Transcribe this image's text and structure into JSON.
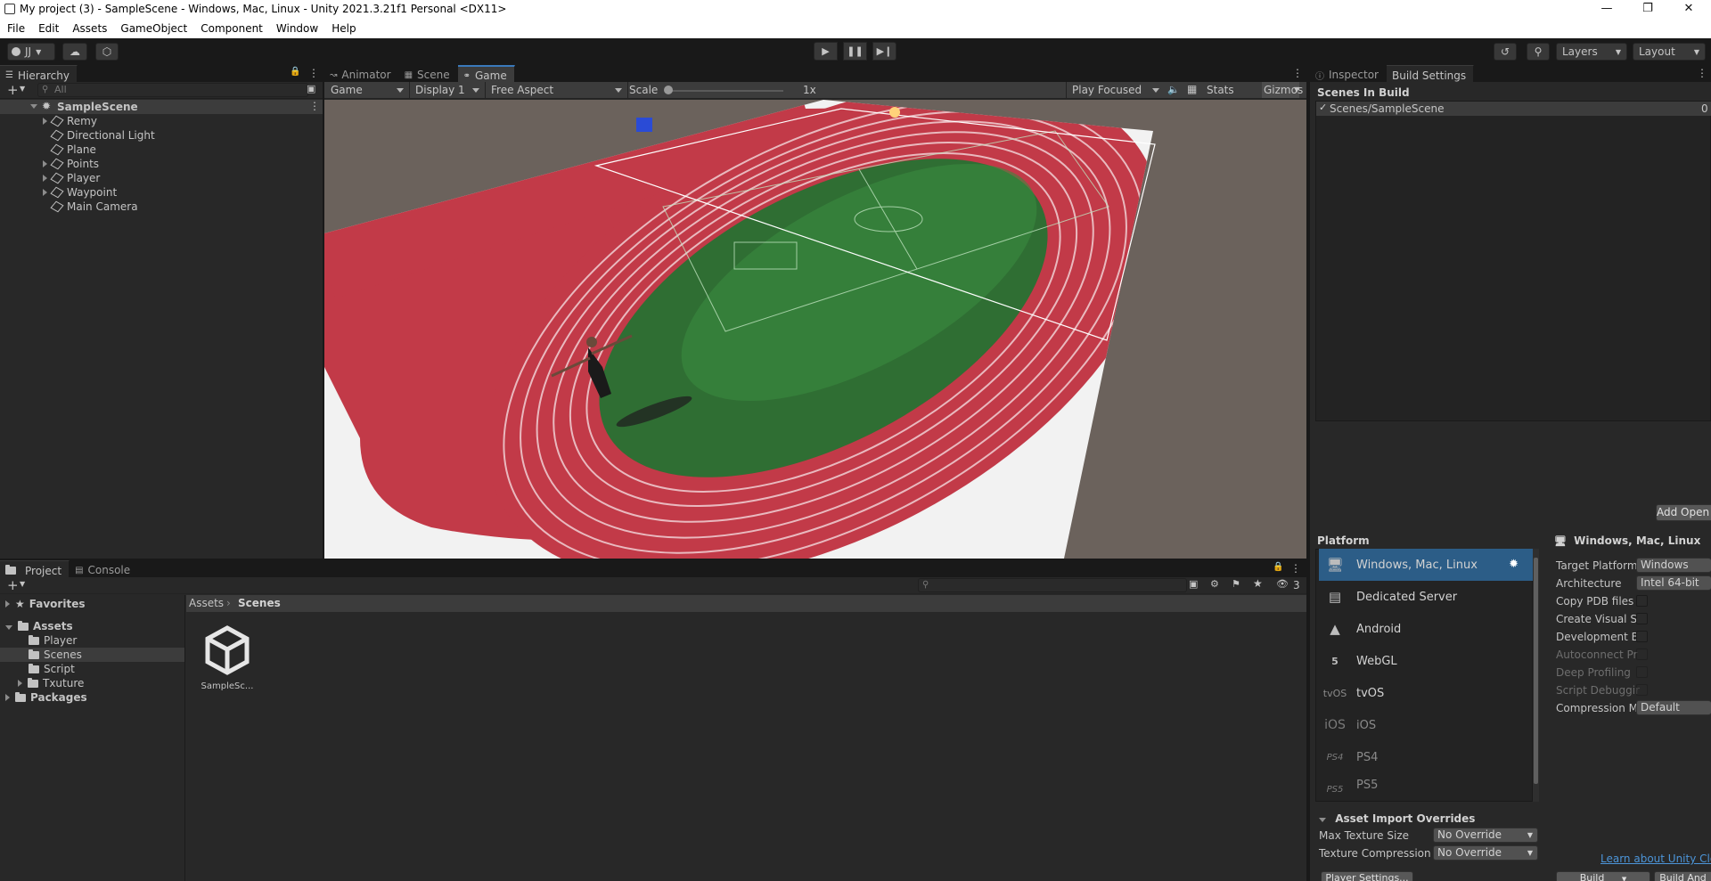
{
  "window": {
    "title": "My project (3) - SampleScene - Windows, Mac, Linux - Unity 2021.3.21f1 Personal <DX11>"
  },
  "menu": [
    "File",
    "Edit",
    "Assets",
    "GameObject",
    "Component",
    "Window",
    "Help"
  ],
  "toolbar": {
    "account": "JJ",
    "layers": "Layers",
    "layout": "Layout"
  },
  "hierarchy": {
    "tab": "Hierarchy",
    "search_placeholder": "All",
    "scene": "SampleScene",
    "items": [
      "Remy",
      "Directional Light",
      "Plane",
      "Points",
      "Player",
      "Waypoint",
      "Main Camera"
    ]
  },
  "center_tabs": [
    "Animator",
    "Scene",
    "Game"
  ],
  "game_bar": {
    "mode": "Game",
    "display": "Display 1",
    "aspect": "Free Aspect",
    "scale_label": "Scale",
    "scale_value": "1x",
    "play_mode": "Play Focused",
    "stats": "Stats",
    "gizmos": "Gizmos"
  },
  "right_tabs": [
    "Inspector",
    "Build Settings"
  ],
  "build": {
    "scenes_header": "Scenes In Build",
    "scene_entry": "Scenes/SampleScene",
    "scene_index": "0",
    "add_open": "Add Open S",
    "platform_header": "Platform",
    "platforms": [
      "Windows, Mac, Linux",
      "Dedicated Server",
      "Android",
      "WebGL",
      "tvOS",
      "iOS",
      "PS4",
      "PS5"
    ],
    "platform_icons": [
      "monitor-icon",
      "server-icon",
      "android-icon",
      "html5-icon",
      "tvos-icon",
      "ios-icon",
      "ps4-icon",
      "ps5-icon"
    ],
    "selected_title": "Windows, Mac, Linux",
    "props": [
      {
        "label": "Target Platform",
        "value": "Windows"
      },
      {
        "label": "Architecture",
        "value": "Intel 64-bit"
      },
      {
        "label": "Copy PDB files",
        "value": ""
      },
      {
        "label": "Create Visual S",
        "value": ""
      },
      {
        "label": "Development B",
        "value": ""
      },
      {
        "label": "Autoconnect Pr",
        "value": ""
      },
      {
        "label": "Deep Profiling",
        "value": ""
      },
      {
        "label": "Script Debuggir",
        "value": ""
      },
      {
        "label": "Compression M",
        "value": "Default"
      }
    ],
    "overrides_header": "Asset Import Overrides",
    "max_texture_label": "Max Texture Size",
    "max_texture_value": "No Override",
    "texture_comp_label": "Texture Compression",
    "texture_comp_value": "No Override",
    "learn_link": "Learn about Unity Clo",
    "player_settings": "Player Settings...",
    "build_btn": "Build",
    "build_and_run": "Build And"
  },
  "project": {
    "tabs": [
      "Project",
      "Console"
    ],
    "favorites": "Favorites",
    "assets": "Assets",
    "folders": [
      "Player",
      "Scenes",
      "Script",
      "Txuture"
    ],
    "packages": "Packages",
    "breadcrumb": [
      "Assets",
      "Scenes"
    ],
    "hidden_count": "3",
    "asset_items": [
      "SampleSc..."
    ]
  },
  "colors": {
    "accent": "#3a79bb",
    "selection": "#2c5d87",
    "track": "#c23a48",
    "field": "#2f6e33"
  }
}
